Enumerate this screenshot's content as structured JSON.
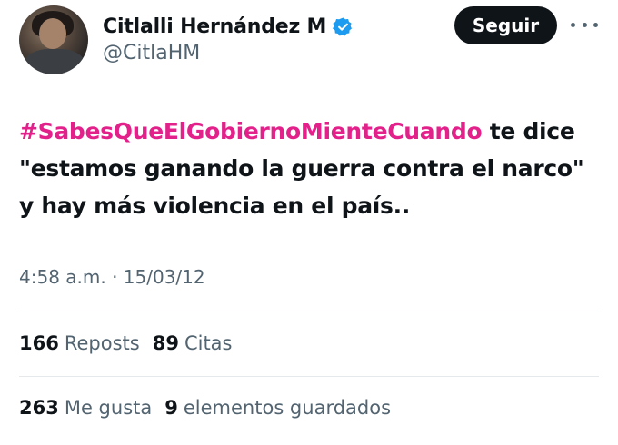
{
  "author": {
    "display_name": "Citlalli Hernández M",
    "handle": "@CitlaHM",
    "verified": true
  },
  "actions": {
    "follow_label": "Seguir",
    "more_icon": "more-horizontal-icon"
  },
  "tweet": {
    "hashtag": "#SabesQueElGobiernoMienteCuando",
    "body": " te dice \"estamos ganando la guerra contra el narco\" y hay más violencia en el país..",
    "timestamp": "4:58 a.m. · 15/03/12"
  },
  "stats": {
    "reposts_count": "166",
    "reposts_label": "Reposts",
    "quotes_count": "89",
    "quotes_label": "Citas",
    "likes_count": "263",
    "likes_label": "Me gusta",
    "bookmarks_count": "9",
    "bookmarks_label": "elementos guardados"
  },
  "colors": {
    "hashtag": "#e3218a",
    "verified": "#1d9bf0",
    "secondary_text": "#536471",
    "button_bg": "#0f1419"
  }
}
